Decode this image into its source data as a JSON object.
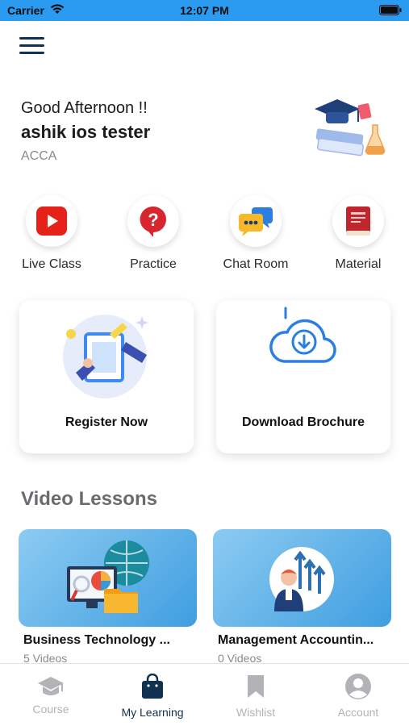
{
  "status_bar": {
    "carrier": "Carrier",
    "time": "12:07 PM"
  },
  "header": {
    "greeting": "Good Afternoon !!",
    "user_name": "ashik ios tester",
    "program": "ACCA"
  },
  "quick_actions": [
    {
      "label": "Live Class",
      "icon": "youtube-play-icon"
    },
    {
      "label": "Practice",
      "icon": "question-bubble-icon"
    },
    {
      "label": "Chat Room",
      "icon": "chat-bubbles-icon"
    },
    {
      "label": "Material",
      "icon": "book-icon"
    }
  ],
  "cards": {
    "register": "Register Now",
    "brochure": "Download Brochure"
  },
  "video_lessons": {
    "title": "Video Lessons",
    "items": [
      {
        "title": "Business Technology ...",
        "count": "5 Videos"
      },
      {
        "title": "Management Accountin...",
        "count": "0 Videos"
      }
    ]
  },
  "tab_bar": {
    "items": [
      {
        "label": "Course",
        "icon": "graduation-cap-icon",
        "active": false
      },
      {
        "label": "My Learning",
        "icon": "shopping-bag-icon",
        "active": true
      },
      {
        "label": "Wishlist",
        "icon": "bookmark-icon",
        "active": false
      },
      {
        "label": "Account",
        "icon": "account-circle-icon",
        "active": false
      }
    ]
  },
  "colors": {
    "status_bar": "#2a9bf0",
    "primary_navy": "#12304f",
    "inactive_tab": "#b3b3b7",
    "youtube_red": "#e62117",
    "thumbnail_blue": "#3f9ee0"
  }
}
